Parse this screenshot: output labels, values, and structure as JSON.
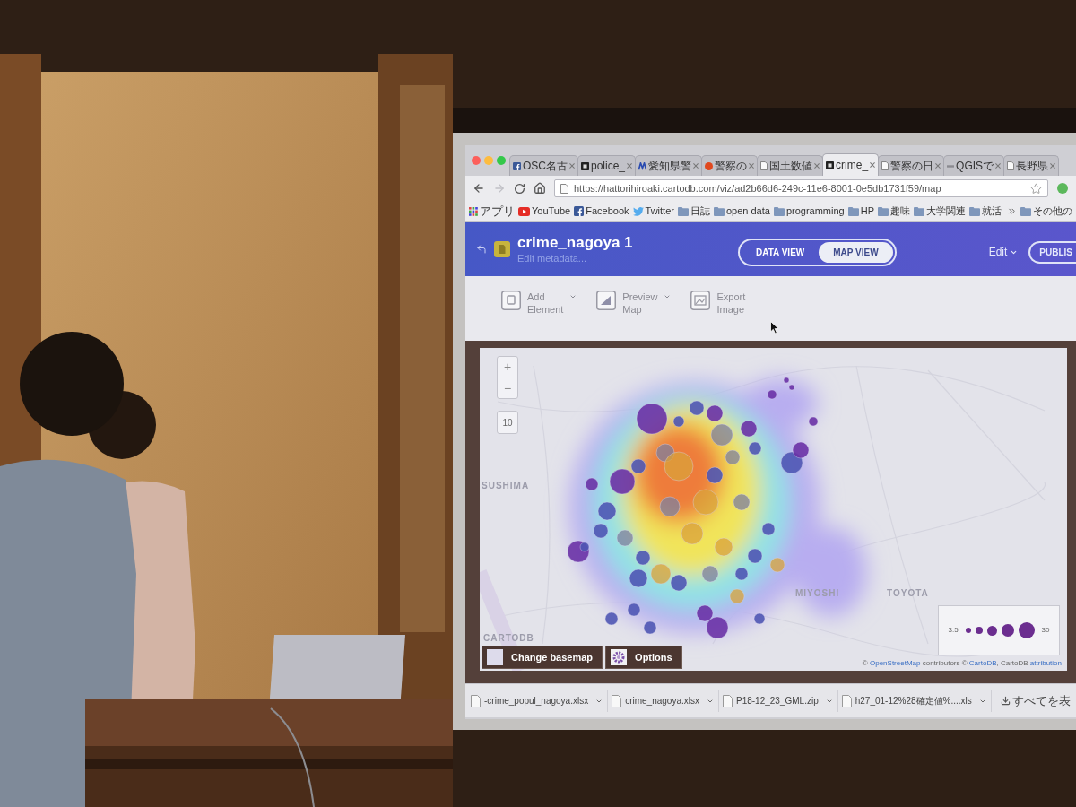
{
  "browser": {
    "tabs": [
      {
        "kind": "facebook",
        "label": "OSC名古",
        "selected": false
      },
      {
        "kind": "dark",
        "label": "police_",
        "selected": false
      },
      {
        "kind": "blue",
        "label": "愛知県警",
        "selected": false
      },
      {
        "kind": "red",
        "label": "警察の",
        "selected": false
      },
      {
        "kind": "page",
        "label": "国土数値",
        "selected": false
      },
      {
        "kind": "dark",
        "label": "crime_",
        "selected": true
      },
      {
        "kind": "page",
        "label": "警察の日",
        "selected": false
      },
      {
        "kind": "dash",
        "label": "QGISで",
        "selected": false
      },
      {
        "kind": "page",
        "label": "長野県",
        "selected": false
      }
    ],
    "forward_disabled": true,
    "address": {
      "url": "https://hattorihiroaki.cartodb.com/viz/ad2b66d6-249c-11e6-8001-0e5db1731f59/map"
    },
    "bookmarks": [
      {
        "kind": "apps",
        "label": "アプリ"
      },
      {
        "kind": "youtube",
        "label": "YouTube"
      },
      {
        "kind": "facebook",
        "label": "Facebook"
      },
      {
        "kind": "twitter",
        "label": "Twitter"
      },
      {
        "kind": "folder",
        "label": "日誌"
      },
      {
        "kind": "folder",
        "label": "open data"
      },
      {
        "kind": "folder",
        "label": "programming"
      },
      {
        "kind": "folder",
        "label": "HP"
      },
      {
        "kind": "folder",
        "label": "趣味"
      },
      {
        "kind": "folder",
        "label": "大学関連"
      },
      {
        "kind": "folder",
        "label": "就活"
      }
    ],
    "other_bookmarks": "その他の"
  },
  "app_header": {
    "title": "crime_nagoya 1",
    "subtitle": "Edit metadata...",
    "view_toggle": [
      {
        "label": "DATA VIEW",
        "selected": false
      },
      {
        "label": "MAP VIEW",
        "selected": true
      }
    ],
    "edit_menu": "Edit",
    "publish_button": "PUBLIS"
  },
  "toolbar": [
    {
      "kind": "element",
      "label": "Add Element",
      "dropdown": true
    },
    {
      "kind": "preview",
      "label": "Preview Map",
      "dropdown": true
    },
    {
      "kind": "export",
      "label": "Export Image",
      "dropdown": false
    }
  ],
  "map": {
    "zoom_in": "+",
    "zoom_out": "−",
    "zoom_level": "10",
    "places": [
      {
        "label": "SUSHIMA"
      },
      {
        "label": "MIYOSHI"
      },
      {
        "label": "TOYOTA"
      },
      {
        "label": "CARTODB"
      }
    ],
    "legend": {
      "min": "3.5",
      "max": "30"
    },
    "buttons": [
      {
        "kind": "basemap",
        "label": "Change basemap"
      },
      {
        "kind": "options",
        "label": "Options"
      }
    ],
    "attribution": [
      {
        "kind": "text",
        "text": "© "
      },
      {
        "kind": "link",
        "text": "OpenStreetMap"
      },
      {
        "kind": "text",
        "text": " contributors © "
      },
      {
        "kind": "link",
        "text": "CartoDB"
      },
      {
        "kind": "text",
        "text": ", CartoDB "
      },
      {
        "kind": "link",
        "text": "attribution"
      }
    ]
  },
  "downloads": {
    "files": [
      {
        "name": "-crime_popul_nagoya.xlsx"
      },
      {
        "name": "crime_nagoya.xlsx"
      },
      {
        "name": "P18-12_23_GML.zip"
      },
      {
        "name": "h27_01-12%28確定値%....xls"
      }
    ],
    "show_all": "すべてを表"
  }
}
